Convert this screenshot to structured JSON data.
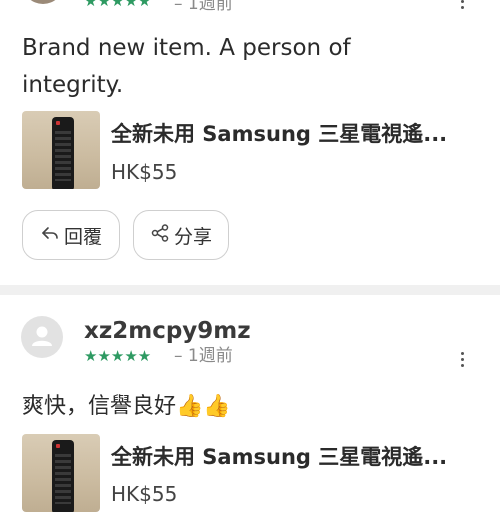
{
  "review1": {
    "stars": "★★★★★",
    "time": "– 1週前",
    "text": "Brand new item. A person of integrity.",
    "product_title": "全新未用 Samsung 三星電視遙...",
    "product_price": "HK$55",
    "reply_label": "回覆",
    "share_label": "分享"
  },
  "review2": {
    "username": "xz2mcpy9mz",
    "stars": "★★★★★",
    "time": "– 1週前",
    "text": "爽快，信譽良好👍👍",
    "product_title": "全新未用 Samsung 三星電視遙...",
    "product_price": "HK$55"
  },
  "colors": {
    "star_green": "#2e9a62",
    "divider": "#f0f0f0"
  },
  "icons": [
    "kebab-menu-icon",
    "reply-icon",
    "share-icon",
    "default-avatar-icon"
  ]
}
